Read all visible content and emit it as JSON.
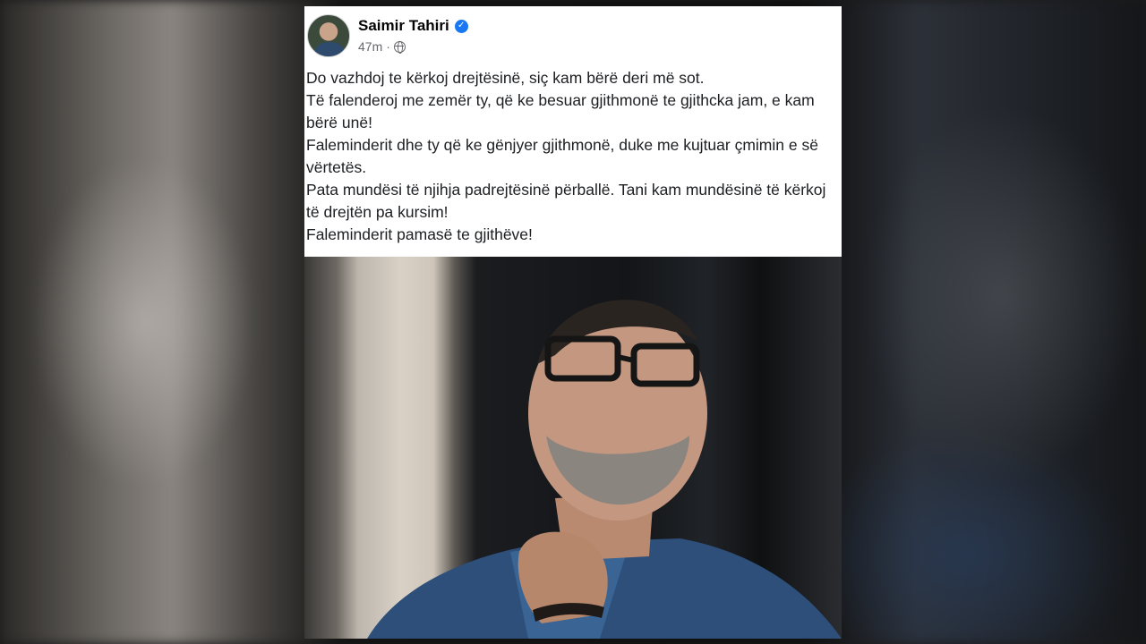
{
  "post": {
    "author": "Saimir Tahiri",
    "verified_icon": "verified-badge-icon",
    "time": "47m",
    "separator": "·",
    "privacy_icon": "globe-icon",
    "lines": [
      "Do vazhdoj te kërkoj drejtësinë, siç kam bërë deri më sot.",
      "Të falenderoj me zemër ty, që ke besuar gjithmonë te gjithcka jam, e kam bërë unë!",
      "Faleminderit dhe ty që ke gënjyer gjithmonë, duke me kujtuar çmimin e së vërtetës.",
      "Pata mundësi të njihja padrejtësinë përballë. Tani kam mundësinë të kërkoj të drejtën pa kursim!",
      "Faleminderit pamasë te gjithëve!"
    ]
  },
  "colors": {
    "verified": "#1877f2",
    "text": "#1c1e21",
    "meta": "#65676b",
    "card": "#ffffff"
  }
}
